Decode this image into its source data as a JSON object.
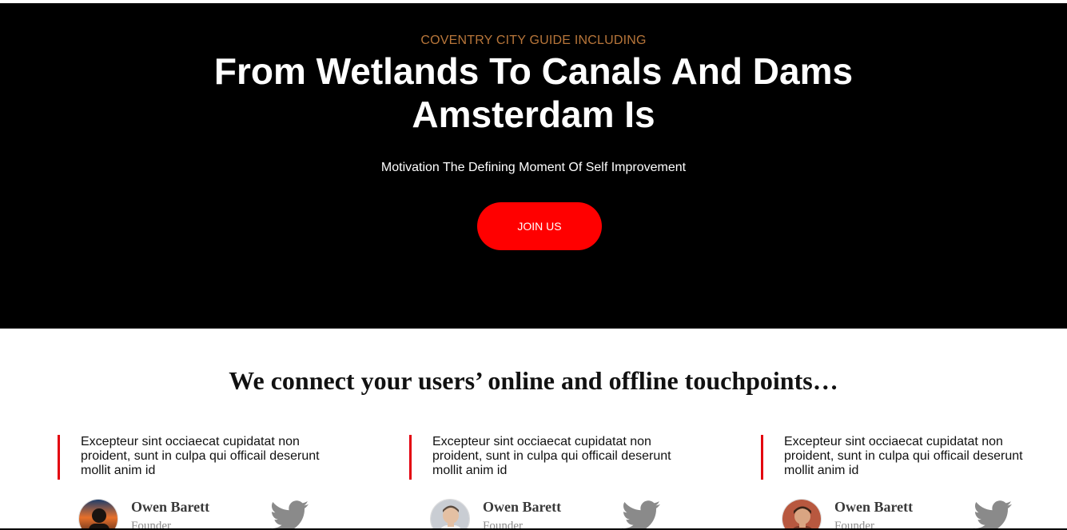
{
  "hero": {
    "eyebrow": "COVENTRY CITY GUIDE INCLUDING",
    "title_line1": "From Wetlands To Canals And Dams",
    "title_line2": "Amsterdam Is",
    "subtitle": "Motivation The Defining Moment Of Self Improvement",
    "cta_label": "JOIN US"
  },
  "section": {
    "heading": "We connect your users’ online and offline touchpoints…"
  },
  "testimonials": [
    {
      "quote": "Excepteur sint occiaecat cupidatat non proident, sunt in culpa qui officail deserunt mollit anim id",
      "name": "Owen Barett",
      "role": "Founder",
      "avatar": "avatar-sunset-photo",
      "social_icon": "twitter-icon"
    },
    {
      "quote": "Excepteur sint occiaecat cupidatat non proident, sunt in culpa qui officail deserunt mollit anim id",
      "name": "Owen Barett",
      "role": "Founder",
      "avatar": "avatar-man-gray-photo",
      "social_icon": "twitter-icon"
    },
    {
      "quote": "Excepteur sint occiaecat cupidatat non proident, sunt in culpa qui officail deserunt mollit anim id",
      "name": "Owen Barett",
      "role": "Founder",
      "avatar": "avatar-man-red-photo",
      "social_icon": "twitter-icon"
    }
  ],
  "colors": {
    "hero_background": "#000000",
    "eyebrow": "#b8763a",
    "cta_background": "#ff0000",
    "quote_border": "#e3000f",
    "twitter_icon": "#8a8a8a"
  }
}
